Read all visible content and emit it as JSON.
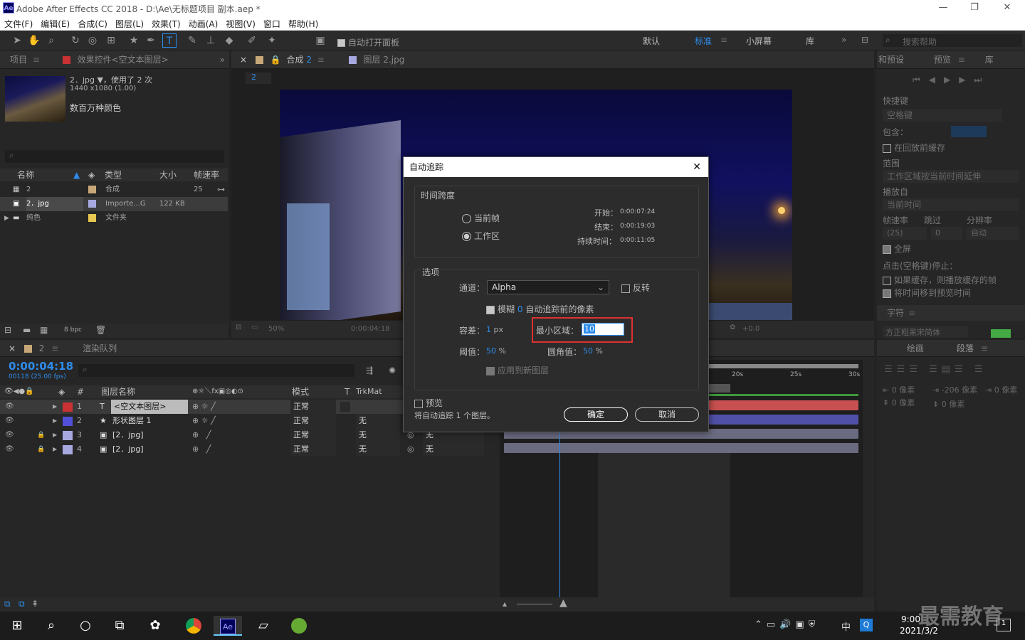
{
  "window": {
    "title": "Adobe After Effects CC 2018 - D:\\Ae\\无标题项目 副本.aep *",
    "logo": "Ae",
    "min": "—",
    "max": "❐",
    "close": "✕"
  },
  "menu": [
    "文件(F)",
    "编辑(E)",
    "合成(C)",
    "图层(L)",
    "效果(T)",
    "动画(A)",
    "视图(V)",
    "窗口",
    "帮助(H)"
  ],
  "toolbar": {
    "auto_open": "自动打开面板",
    "workspaces": [
      "默认",
      "标准",
      "小屏幕",
      "库"
    ],
    "search_placeholder": "搜索帮助"
  },
  "project": {
    "tab": "项目",
    "effects_tab": "效果控件<空文本图层>",
    "item_name": "2．jpg ▼，使用了 2 次",
    "item_dims": "1440 x1080 (1.00)",
    "item_color": "数百万种颜色",
    "columns": [
      "名称",
      "类型",
      "大小",
      "帧速率"
    ],
    "rows": [
      {
        "name": "2",
        "type": "合成",
        "size": "",
        "fps": "25",
        "color": "#c8a878"
      },
      {
        "name": "2．jpg",
        "type": "Importe...G",
        "size": "122 KB",
        "fps": "",
        "color": "#a8a8e0"
      },
      {
        "name": "纯色",
        "type": "文件夹",
        "size": "",
        "fps": "",
        "color": "#e8c850"
      }
    ],
    "bpc": "8 bpc"
  },
  "comp": {
    "tab": "合成 2",
    "layer_tab": "图层 2.jpg",
    "sub_tab": "2",
    "zoom": "50%",
    "time": "0:00:04:18",
    "exposure": "+0.0"
  },
  "right": {
    "tab1": "和预设",
    "tab2": "预览",
    "tab3": "库",
    "shortcut_label": "快捷键",
    "shortcut_value": "空格键",
    "include": "包含：",
    "cache_before": "在回放前缓存",
    "range_label": "范围",
    "range_value": "工作区域按当前时间延伸",
    "play_from_label": "播放自",
    "play_from_value": "当前时间",
    "fps_label": "帧速率",
    "skip_label": "跳过",
    "res_label": "分辨率",
    "fps_value": "(25)",
    "skip_value": "0",
    "res_value": "自动",
    "fullscreen": "全屏",
    "stop_label": "点击(空格键)停止：",
    "opt1": "如果缓存，则播放缓存的帧",
    "opt2": "将时间移到预览时间",
    "char_tab": "字符",
    "font_value": "方正粗黑宋简体"
  },
  "timeline": {
    "tab": "2",
    "queue_tab": "渲染队列",
    "time": "0:00:04:18",
    "frames": "00118 (25.00 fps)",
    "col_name": "图层名称",
    "col_mode": "模式",
    "col_trkmat": "TrkMat",
    "ruler": [
      "20s",
      "25s",
      "30s"
    ],
    "layers": [
      {
        "num": "1",
        "type": "T",
        "name": "<空文本图层>",
        "mode": "正常",
        "trk": "",
        "color": "#c83232"
      },
      {
        "num": "2",
        "type": "★",
        "name": "形状图层 1",
        "mode": "正常",
        "trk": "无",
        "color": "#5050d8"
      },
      {
        "num": "3",
        "type": "▣",
        "name": "[2．jpg]",
        "mode": "正常",
        "trk": "无",
        "color": "#a8a8e0"
      },
      {
        "num": "4",
        "type": "▣",
        "name": "[2．jpg]",
        "mode": "正常",
        "trk": "无",
        "color": "#a8a8e0"
      }
    ],
    "parent": "无"
  },
  "rbot": {
    "tab1": "绘画",
    "tab2": "段落",
    "indent_l": "0 像素",
    "indent_r": "-206 像素",
    "indent_first": "0 像素",
    "space_before": "0 像素",
    "space_after": "0 像素"
  },
  "dialog": {
    "title": "自动追踪",
    "close": "✕",
    "time_group": "时间跨度",
    "opt_current": "当前帧",
    "opt_work": "工作区",
    "start_label": "开始：",
    "start": "0:00:07:24",
    "end_label": "结束：",
    "end": "0:00:19:03",
    "dur_label": "持续时间：",
    "dur": "0:00:11:05",
    "opt_group": "选项",
    "channel_label": "通道：",
    "channel": "Alpha",
    "invert": "反转",
    "blur_label": "模糊",
    "blur_val": "0",
    "blur_suffix": "自动追踪前的像素",
    "tol_label": "容差：",
    "tol_val": "1",
    "tol_unit": "px",
    "min_label": "最小区域：",
    "min_val": "10",
    "thresh_label": "阈值：",
    "thresh_val": "50",
    "thresh_unit": "%",
    "corner_label": "圆角值：",
    "corner_val": "50",
    "corner_unit": "%",
    "apply_new": "应用到新图层",
    "preview": "预览",
    "note": "将自动追踪 1 个图层。",
    "ok": "确定",
    "cancel": "取消"
  },
  "taskbar": {
    "time": "9:00",
    "date": "2021/3/2",
    "ime": "中",
    "watermark": "最需教育",
    "notif": "1"
  }
}
